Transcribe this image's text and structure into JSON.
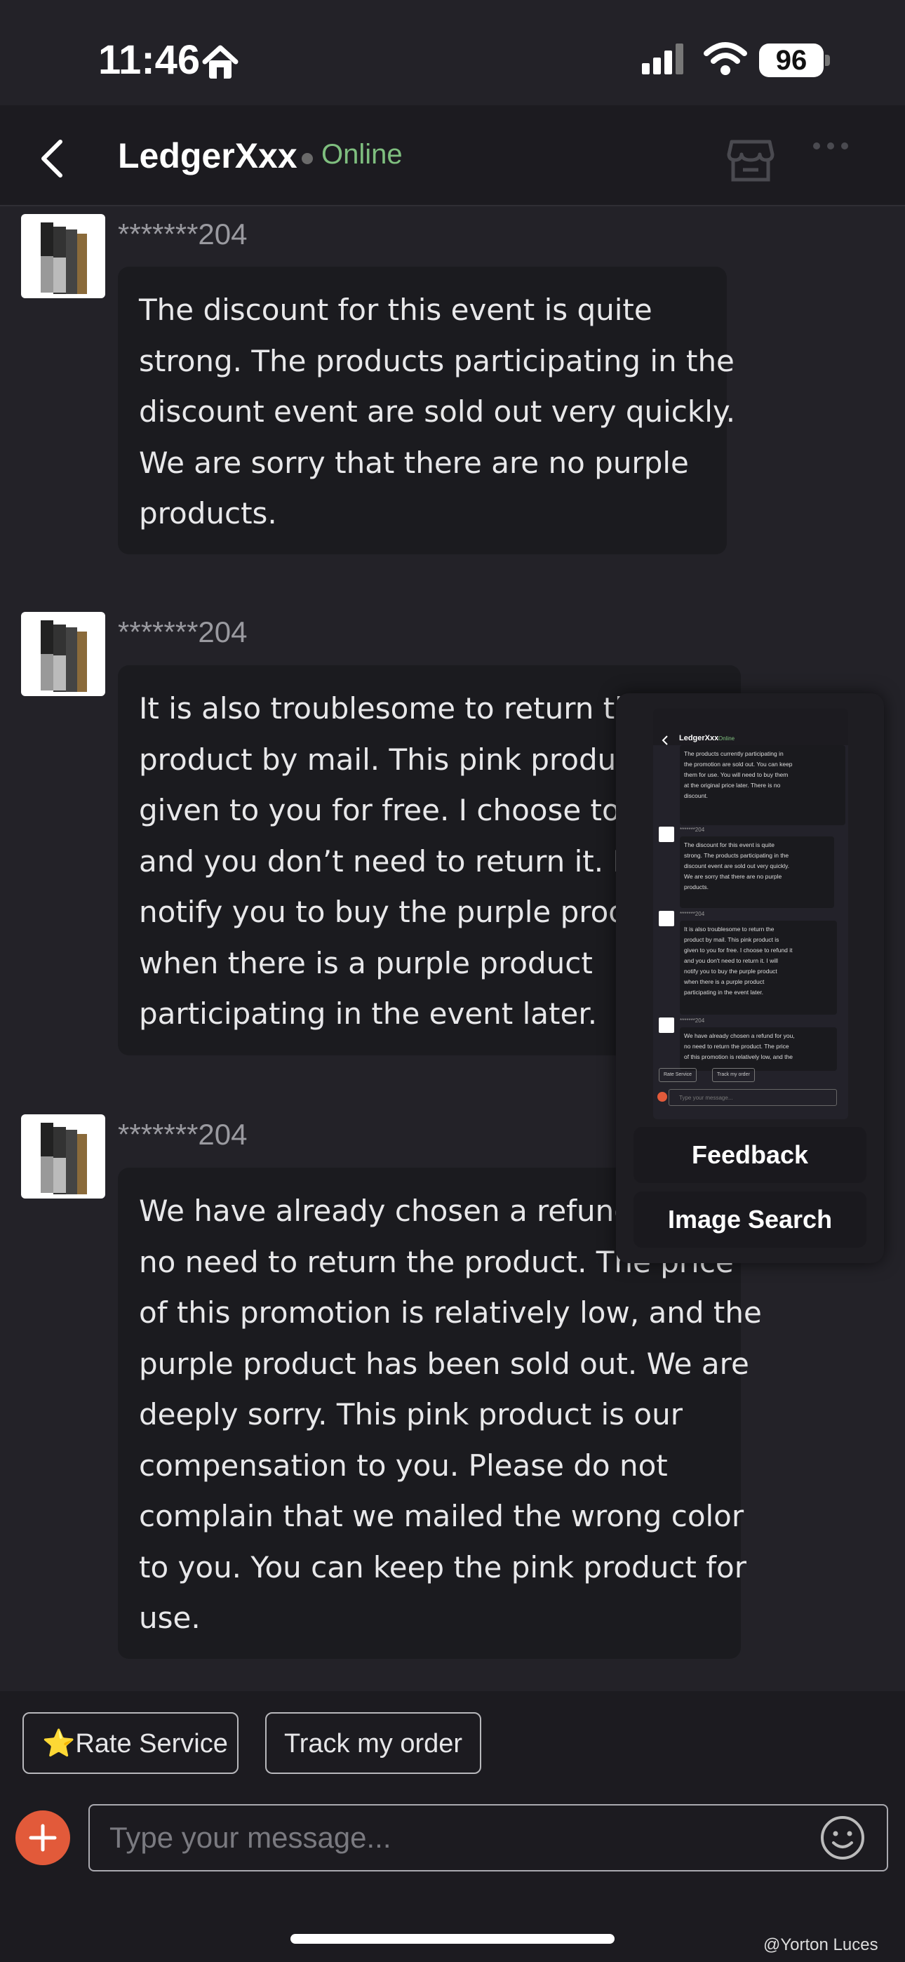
{
  "status_bar": {
    "time": "11:46",
    "battery": "96"
  },
  "header": {
    "title": "LedgerXxx",
    "status": "Online"
  },
  "messages": [
    {
      "sender": "*******204",
      "lines": [
        "The discount for this event is quite",
        "strong. The products participating in the",
        "discount event are sold out very quickly.",
        "We are sorry that there are no purple",
        "products."
      ]
    },
    {
      "sender": "*******204",
      "lines": [
        "It is also troublesome to return the",
        "product by mail. This pink product is",
        "given to you for free. I choose to refund it",
        "and you don’t need to return it. I will",
        "notify you to buy the purple product",
        "when there is a purple product",
        "participating in the event later."
      ]
    },
    {
      "sender": "*******204",
      "lines": [
        "We have already chosen a refund for you,",
        "no need to return the product. The price",
        "of this promotion is relatively low, and the",
        "purple product has been sold out. We are",
        "deeply sorry. This pink product is our",
        "compensation to you. Please do not",
        "complain that we mailed the wrong color",
        "to you. You can keep the pink product for",
        "use."
      ]
    }
  ],
  "float_panel": {
    "feedback_label": "Feedback",
    "image_search_label": "Image Search",
    "preview": {
      "title": "LedgerXxx",
      "status": "Online",
      "top_lines": [
        "The products currently participating in",
        "the promotion are sold out. You can keep",
        "them for use. You will need to buy them",
        "at the original price later. There is no",
        "discount."
      ],
      "sender": "*******204",
      "msg1": [
        "The discount for this event is quite",
        "strong. The products participating in the",
        "discount event are sold out very quickly.",
        "We are sorry that there are no purple",
        "products."
      ],
      "msg2": [
        "It is also troublesome to return the",
        "product by mail. This pink product is",
        "given to you for free. I choose to refund it",
        "and you don't need to return it. I will",
        "notify you to buy the purple product",
        "when there is a purple product",
        "participating in the event later."
      ],
      "msg3": [
        "We have already chosen a refund for you,",
        "no need to return the product. The price",
        "of this promotion is relatively low, and the"
      ],
      "chip_rate": "Rate Service",
      "chip_track": "Track my order",
      "input_placeholder": "Type your message..."
    }
  },
  "quick_replies": {
    "rate_service": "⭐Rate Service",
    "track_order": "Track my order"
  },
  "composer": {
    "placeholder": "Type your message..."
  },
  "watermark": "@Yorton Luces",
  "colors": {
    "accent_plus": "#e25a3a",
    "online": "#7fbf7f",
    "background": "#232228"
  }
}
